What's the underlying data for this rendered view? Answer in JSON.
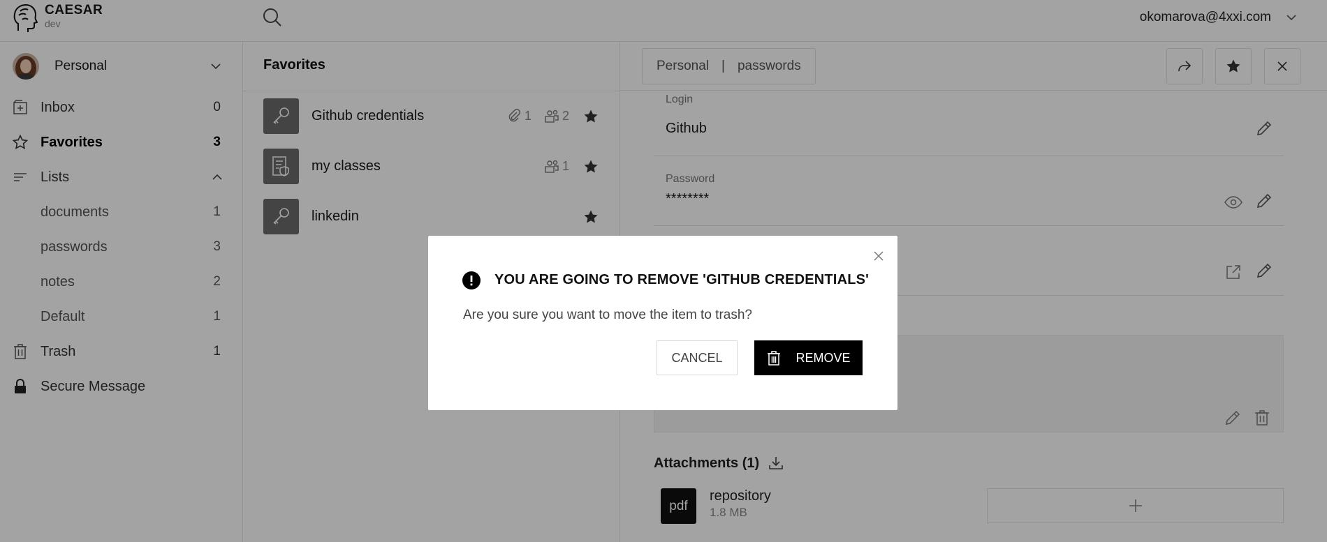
{
  "app": {
    "name": "CAESAR",
    "env": "dev",
    "user_email": "okomarova@4xxi.com"
  },
  "account": {
    "name": "Personal"
  },
  "sidebar": {
    "items": [
      {
        "label": "Inbox",
        "count": "0",
        "icon": "inbox-icon"
      },
      {
        "label": "Favorites",
        "count": "3",
        "icon": "star-outline-icon"
      },
      {
        "label": "Lists",
        "count": "",
        "icon": "lists-icon"
      },
      {
        "label": "documents",
        "count": "1"
      },
      {
        "label": "passwords",
        "count": "3"
      },
      {
        "label": "notes",
        "count": "2"
      },
      {
        "label": "Default",
        "count": "1"
      },
      {
        "label": "Trash",
        "count": "1",
        "icon": "trash-icon"
      },
      {
        "label": "Secure Message",
        "count": "",
        "icon": "lock-icon"
      }
    ]
  },
  "list": {
    "title": "Favorites",
    "items": [
      {
        "name": "Github credentials",
        "attachments": "1",
        "members": "2",
        "icon": "key-icon"
      },
      {
        "name": "my classes",
        "attachments": "",
        "members": "1",
        "icon": "document-shield-icon"
      },
      {
        "name": "linkedin",
        "attachments": "",
        "members": "",
        "icon": "key-icon"
      }
    ]
  },
  "detail": {
    "crumb_account": "Personal",
    "crumb_sep": "|",
    "crumb_list": "passwords",
    "login_label": "Login",
    "login_value": "Github",
    "password_label": "Password",
    "password_value": "********",
    "attachments_title": "Attachments (1)",
    "file": {
      "type": "pdf",
      "name": "repository",
      "size": "1.8 MB"
    }
  },
  "dialog": {
    "title": "YOU ARE GOING TO REMOVE 'GITHUB CREDENTIALS'",
    "message": "Are you sure you want to move the item to trash?",
    "cancel_label": "CANCEL",
    "remove_label": "REMOVE"
  },
  "colors": {
    "overlay": "#5c5c5c",
    "primary_button": "#000000",
    "icon_tile": "#6b6b6b"
  }
}
